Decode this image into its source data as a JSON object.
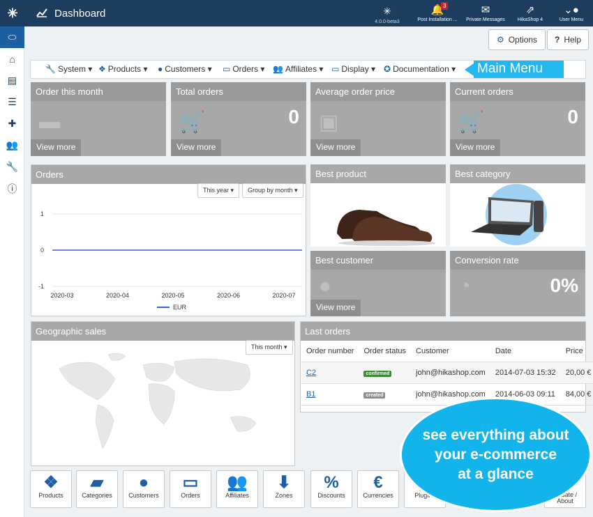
{
  "topbar": {
    "title": "Dashboard",
    "version": "4.0.0-beta3",
    "post_install": "Post Installation ...",
    "post_install_badge": "3",
    "private_messages": "Private Messages",
    "hikashop": "HikaShop 4",
    "user_menu": "User Menu"
  },
  "toolbar": {
    "options": "Options",
    "help": "Help"
  },
  "menu": {
    "system": "System",
    "products": "Products",
    "customers": "Customers",
    "orders": "Orders",
    "affiliates": "Affiliates",
    "display": "Display",
    "documentation": "Documentation"
  },
  "main_menu_label": "Main Menu",
  "tiles": {
    "order_month": "Order this month",
    "total_orders": "Total orders",
    "total_orders_value": "0",
    "avg_price": "Average order price",
    "current_orders": "Current orders",
    "current_orders_value": "0",
    "view_more": "View more",
    "best_product": "Best product",
    "best_category": "Best category",
    "best_customer": "Best customer",
    "conversion": "Conversion rate",
    "conversion_value": "0%"
  },
  "orders_panel": {
    "title": "Orders",
    "period": "This year",
    "group": "Group by month"
  },
  "chart_data": {
    "type": "line",
    "categories": [
      "2020-03",
      "2020-04",
      "2020-05",
      "2020-06",
      "2020-07"
    ],
    "series": [
      {
        "name": "EUR",
        "values": [
          0,
          0,
          0,
          0,
          0
        ]
      }
    ],
    "yticks": [
      "1",
      "0",
      "-1"
    ],
    "ylim": [
      -1,
      1
    ],
    "legend": "bottom"
  },
  "geo": {
    "title": "Geographic sales",
    "period": "This month"
  },
  "last_orders": {
    "title": "Last orders",
    "headers": [
      "Order number",
      "Order status",
      "Customer",
      "Date",
      "Price"
    ],
    "rows": [
      {
        "num": "C2",
        "status": "confirmed",
        "customer": "john@hikashop.com",
        "date": "2014-07-03 15:32",
        "price": "20,00 €"
      },
      {
        "num": "B1",
        "status": "created",
        "customer": "john@hikashop.com",
        "date": "2014-06-03 09:11",
        "price": "84,00 €"
      }
    ]
  },
  "bottom": [
    "Products",
    "Categories",
    "Customers",
    "Orders",
    "Affiliates",
    "Zones",
    "Discounts",
    "Currencies",
    "Plugins",
    "Update / About"
  ],
  "promo": {
    "line1": "see everything about",
    "line2": "your e-commerce",
    "line3": "at a glance"
  },
  "colors": {
    "navy": "#1c3d5e",
    "accent": "#1c5fa3",
    "cyan": "#22b7ee",
    "tile": "#a8a8a8",
    "confirmed": "#3d8a37",
    "created": "#8d8d8d"
  }
}
